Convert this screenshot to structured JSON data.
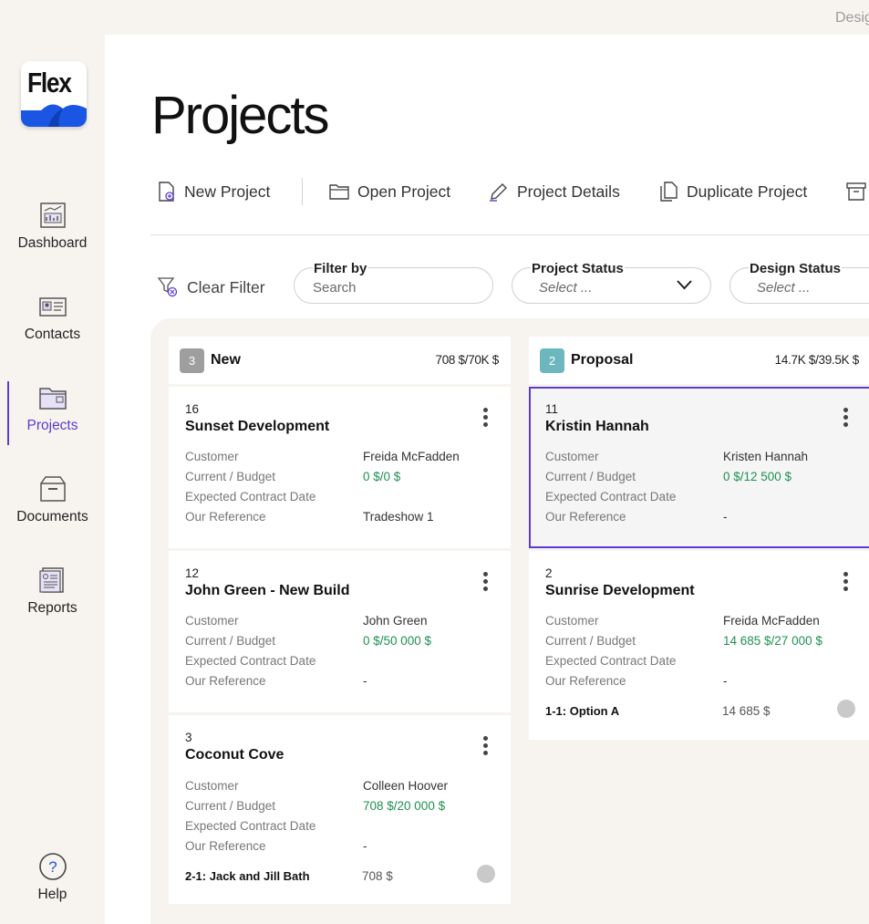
{
  "topbar": {
    "text": "Desig"
  },
  "logo": {
    "text": "Flex"
  },
  "sidebar": {
    "items": [
      {
        "label": "Dashboard",
        "icon": "dashboard-icon"
      },
      {
        "label": "Contacts",
        "icon": "contacts-icon"
      },
      {
        "label": "Projects",
        "icon": "projects-icon",
        "active": true
      },
      {
        "label": "Documents",
        "icon": "documents-icon"
      },
      {
        "label": "Reports",
        "icon": "reports-icon"
      }
    ],
    "help_label": "Help"
  },
  "page": {
    "title": "Projects"
  },
  "toolbar": {
    "new_project": "New Project",
    "open_project": "Open Project",
    "project_details": "Project Details",
    "duplicate_project": "Duplicate Project"
  },
  "filters": {
    "clear_filter": "Clear Filter",
    "filter_by": {
      "label": "Filter by",
      "placeholder": "Search"
    },
    "project_status": {
      "label": "Project Status",
      "placeholder": "Select ..."
    },
    "design_status": {
      "label": "Design Status",
      "placeholder": "Select ..."
    }
  },
  "colors": {
    "accent": "#5b3bd1",
    "green": "#1e9150",
    "badge_new": "#9e9e9e",
    "badge_proposal": "#6cb6bd"
  },
  "columns": [
    {
      "badge": "3",
      "title": "New",
      "sum": "708 $/70K $",
      "cards": [
        {
          "number": "16",
          "title": "Sunset Development",
          "labels": [
            "Customer",
            "Current / Budget",
            "Expected Contract Date",
            "Our Reference"
          ],
          "customer": "Freida McFadden",
          "budget": "0 $/0 $",
          "contract_date": "",
          "reference": "Tradeshow 1"
        },
        {
          "number": "12",
          "title": "John Green - New Build",
          "labels": [
            "Customer",
            "Current / Budget",
            "Expected Contract Date",
            "Our Reference"
          ],
          "customer": "John Green",
          "budget": "0 $/50 000 $",
          "contract_date": "",
          "reference": "-"
        },
        {
          "number": "3",
          "title": "Coconut Cove",
          "labels": [
            "Customer",
            "Current / Budget",
            "Expected Contract Date",
            "Our Reference"
          ],
          "customer": "Colleen Hoover",
          "budget": "708 $/20 000 $",
          "contract_date": "",
          "reference": "-",
          "option": {
            "label": "2-1: Jack and Jill Bath",
            "value": "708 $"
          }
        }
      ]
    },
    {
      "badge": "2",
      "title": "Proposal",
      "sum": "14.7K $/39.5K $",
      "cards": [
        {
          "number": "11",
          "title": "Kristin Hannah",
          "labels": [
            "Customer",
            "Current / Budget",
            "Expected Contract Date",
            "Our Reference"
          ],
          "customer": "Kristen Hannah",
          "budget": "0 $/12 500 $",
          "contract_date": "",
          "reference": "-"
        },
        {
          "number": "2",
          "title": "Sunrise Development",
          "labels": [
            "Customer",
            "Current / Budget",
            "Expected Contract Date",
            "Our Reference"
          ],
          "customer": "Freida McFadden",
          "budget": "14 685 $/27 000 $",
          "contract_date": "",
          "reference": "-",
          "option": {
            "label": "1-1: Option A",
            "value": "14 685 $"
          }
        }
      ]
    }
  ]
}
